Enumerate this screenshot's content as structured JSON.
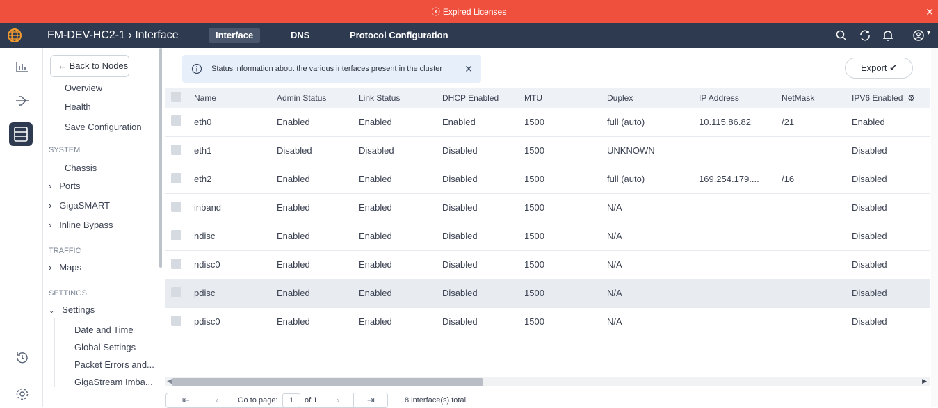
{
  "banner": {
    "text": "Expired Licenses"
  },
  "topbar": {
    "title": "FM-DEV-HC2-1 › Interface",
    "tabs": [
      "Interface",
      "DNS",
      "Protocol Configuration"
    ]
  },
  "nav": {
    "back_label": "← Back to Nodes",
    "items": [
      "Overview",
      "Health",
      "Save Configuration"
    ],
    "system_header": "SYSTEM",
    "system_items": [
      "Chassis",
      "Ports",
      "GigaSMART",
      "Inline Bypass"
    ],
    "traffic_header": "TRAFFIC",
    "traffic_items": [
      "Maps"
    ],
    "settings_header": "SETTINGS",
    "settings_group": "Settings",
    "settings_items": [
      "Date and Time",
      "Global Settings",
      "Packet Errors and...",
      "GigaStream Imba..."
    ]
  },
  "info_message": "Status information about the various interfaces present in the cluster",
  "export_label": "Export",
  "table": {
    "columns": [
      "Name",
      "Admin Status",
      "Link Status",
      "DHCP Enabled",
      "MTU",
      "Duplex",
      "IP Address",
      "NetMask",
      "IPV6 Enabled"
    ],
    "rows": [
      [
        "eth0",
        "Enabled",
        "Enabled",
        "Enabled",
        "1500",
        "full (auto)",
        "10.115.86.82",
        "/21",
        "Enabled"
      ],
      [
        "eth1",
        "Disabled",
        "Disabled",
        "Disabled",
        "1500",
        "UNKNOWN",
        "",
        "",
        "Disabled"
      ],
      [
        "eth2",
        "Enabled",
        "Enabled",
        "Disabled",
        "1500",
        "full (auto)",
        "169.254.179....",
        "/16",
        "Disabled"
      ],
      [
        "inband",
        "Enabled",
        "Enabled",
        "Disabled",
        "1500",
        "N/A",
        "",
        "",
        "Disabled"
      ],
      [
        "ndisc",
        "Enabled",
        "Enabled",
        "Disabled",
        "1500",
        "N/A",
        "",
        "",
        "Disabled"
      ],
      [
        "ndisc0",
        "Enabled",
        "Enabled",
        "Disabled",
        "1500",
        "N/A",
        "",
        "",
        "Disabled"
      ],
      [
        "pdisc",
        "Enabled",
        "Enabled",
        "Disabled",
        "1500",
        "N/A",
        "",
        "",
        "Disabled"
      ],
      [
        "pdisc0",
        "Enabled",
        "Enabled",
        "Disabled",
        "1500",
        "N/A",
        "",
        "",
        "Disabled"
      ]
    ],
    "selected_row": 6
  },
  "pager": {
    "goto_label": "Go to page:",
    "page_value": "1",
    "of_label": "of 1",
    "total_label": "8 interface(s) total"
  },
  "colors": {
    "banner": "#ef4f3d",
    "topbar": "#2e3a4f",
    "header_row": "#eef1f6",
    "info": "#e7effa"
  },
  "icons": [
    "globe-icon",
    "search-icon",
    "refresh-icon",
    "bell-icon",
    "user-icon",
    "chart-icon",
    "topology-icon",
    "server-icon",
    "history-icon",
    "gear-icon",
    "info-icon",
    "close-icon",
    "chevron-down-icon"
  ]
}
